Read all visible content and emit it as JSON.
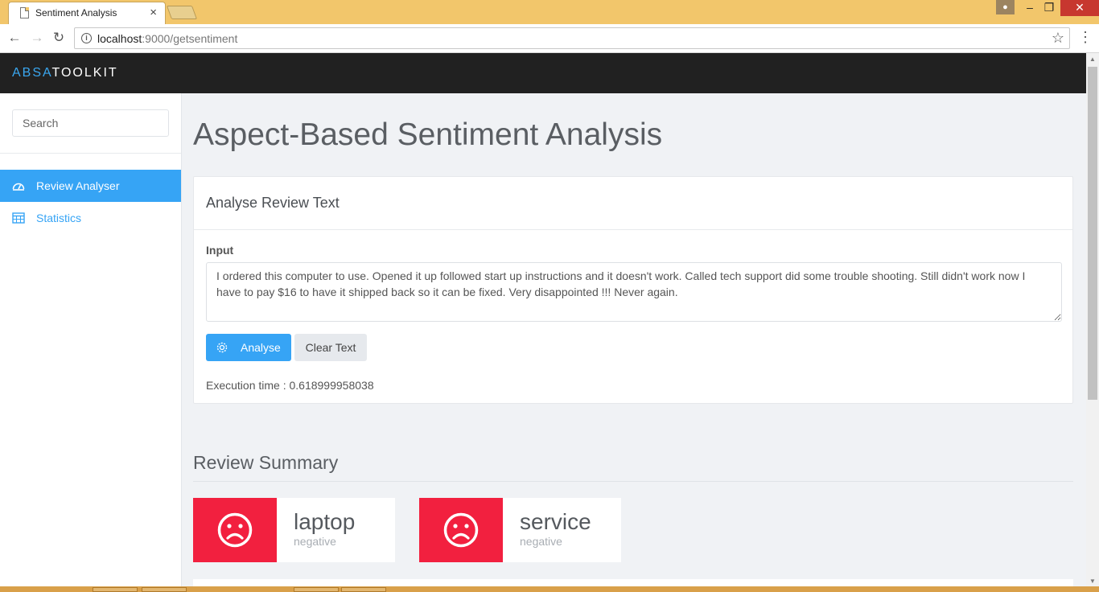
{
  "browser": {
    "tab_title": "Sentiment Analysis",
    "tab_close": "×",
    "url_host": "localhost",
    "url_path": ":9000/getsentiment"
  },
  "app": {
    "brand_accent": "ABSA",
    "brand_rest": "TOOLKIT",
    "accent_color": "#36a4f5",
    "negative_color": "#f2203f"
  },
  "sidebar": {
    "search_placeholder": "Search",
    "items": [
      {
        "label": "Review Analyser",
        "icon": "speedometer-icon",
        "active": true
      },
      {
        "label": "Statistics",
        "icon": "calendar-icon",
        "active": false
      }
    ]
  },
  "main": {
    "page_title": "Aspect-Based Sentiment Analysis",
    "card": {
      "title": "Analyse Review Text",
      "input_label": "Input",
      "review_text": "I ordered this computer to use. Opened it up followed start up instructions and it doesn't work. Called tech support did some trouble shooting. Still didn't work now I have to pay $16 to have it shipped back so it can be fixed. Very disappointed !!! Never again.",
      "analyse_label": "Analyse",
      "clear_label": "Clear Text",
      "execution_time": "Execution time : 0.618999958038"
    },
    "summary": {
      "title": "Review Summary",
      "aspects": [
        {
          "name": "laptop",
          "polarity": "negative",
          "icon": "sad-face-icon"
        },
        {
          "name": "service",
          "polarity": "negative",
          "icon": "sad-face-icon"
        }
      ]
    }
  }
}
